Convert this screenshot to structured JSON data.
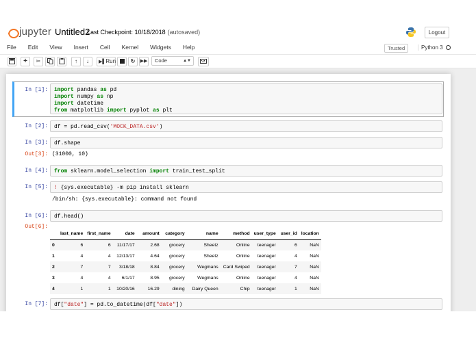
{
  "header": {
    "logo_text": "jupyter",
    "notebook_name": "Untitled2",
    "checkpoint": "Last Checkpoint: 10/18/2018",
    "autosave": "(autosaved)",
    "logout_label": "Logout"
  },
  "menu": {
    "items": [
      "File",
      "Edit",
      "View",
      "Insert",
      "Cell",
      "Kernel",
      "Widgets",
      "Help"
    ],
    "trusted": "Trusted",
    "kernel_name": "Python 3"
  },
  "toolbar": {
    "run_label": "Run",
    "cell_type": "Code"
  },
  "cells": {
    "c1": {
      "prompt": "In [1]:"
    },
    "c2": {
      "prompt": "In [2]:"
    },
    "c3": {
      "prompt": "In [3]:",
      "out_prompt": "Out[3]:",
      "output": "(31000, 10)"
    },
    "c4": {
      "prompt": "In [4]:"
    },
    "c5": {
      "prompt": "In [5]:",
      "output": "/bin/sh: {sys.executable}: command not found"
    },
    "c6": {
      "prompt": "In [6]:",
      "out_prompt": "Out[6]:"
    },
    "c7": {
      "prompt": "In [7]:"
    }
  },
  "code": {
    "c1_l1_a": "import",
    "c1_l1_b": " pandas ",
    "c1_l1_c": "as",
    "c1_l1_d": " pd",
    "c1_l2_a": "import",
    "c1_l2_b": " numpy ",
    "c1_l2_c": "as",
    "c1_l2_d": " np",
    "c1_l3_a": "import",
    "c1_l3_b": " datetime",
    "c1_l4_a": "from",
    "c1_l4_b": " matplotlib ",
    "c1_l4_c": "import",
    "c1_l4_d": " pyplot ",
    "c1_l4_e": "as",
    "c1_l4_f": " plt",
    "c2_a": "df = pd.read_csv(",
    "c2_b": "'MOCK_DATA.csv'",
    "c2_c": ")",
    "c3": "df.shape",
    "c4_a": "from",
    "c4_b": " sklearn.model_selection ",
    "c4_c": "import",
    "c4_d": " train_test_split",
    "c5_a": "!",
    "c5_b": " {sys.executable} -m pip install sklearn",
    "c6": "df.head()",
    "c7_a": "df[",
    "c7_b": "\"date\"",
    "c7_c": "] = pd.to_datetime(df[",
    "c7_d": "\"date\"",
    "c7_e": "])"
  },
  "dataframe": {
    "columns": [
      "",
      "last_name",
      "first_name",
      "date",
      "amount",
      "category",
      "name",
      "method",
      "user_type",
      "user_id",
      "location"
    ],
    "rows": [
      [
        "0",
        "6",
        "6",
        "11/17/17",
        "2.68",
        "grocery",
        "Sheetz",
        "Online",
        "teenager",
        "6",
        "NaN"
      ],
      [
        "1",
        "4",
        "4",
        "12/13/17",
        "4.64",
        "grocery",
        "Sheetz",
        "Online",
        "teenager",
        "4",
        "NaN"
      ],
      [
        "2",
        "7",
        "7",
        "3/18/18",
        "8.84",
        "grocery",
        "Wegmans",
        "Card Swiped",
        "teenager",
        "7",
        "NaN"
      ],
      [
        "3",
        "4",
        "4",
        "6/1/17",
        "8.95",
        "grocery",
        "Wegmans",
        "Online",
        "teenager",
        "4",
        "NaN"
      ],
      [
        "4",
        "1",
        "1",
        "10/20/16",
        "16.29",
        "dining",
        "Dairy Queen",
        "Chip",
        "teenager",
        "1",
        "NaN"
      ]
    ]
  },
  "icons": [
    "save-icon",
    "plus-icon",
    "cut-icon",
    "copy-icon",
    "paste-icon",
    "arrow-up-icon",
    "arrow-down-icon",
    "run-icon",
    "stop-icon",
    "restart-icon",
    "fast-forward-icon",
    "keyboard-icon",
    "python-logo"
  ],
  "colors": {
    "prompt_in": "#303f9f",
    "prompt_out": "#d84315",
    "keyword": "#008000",
    "string": "#ba2121",
    "selected": "#42a5f5",
    "logo": "#f37726"
  }
}
